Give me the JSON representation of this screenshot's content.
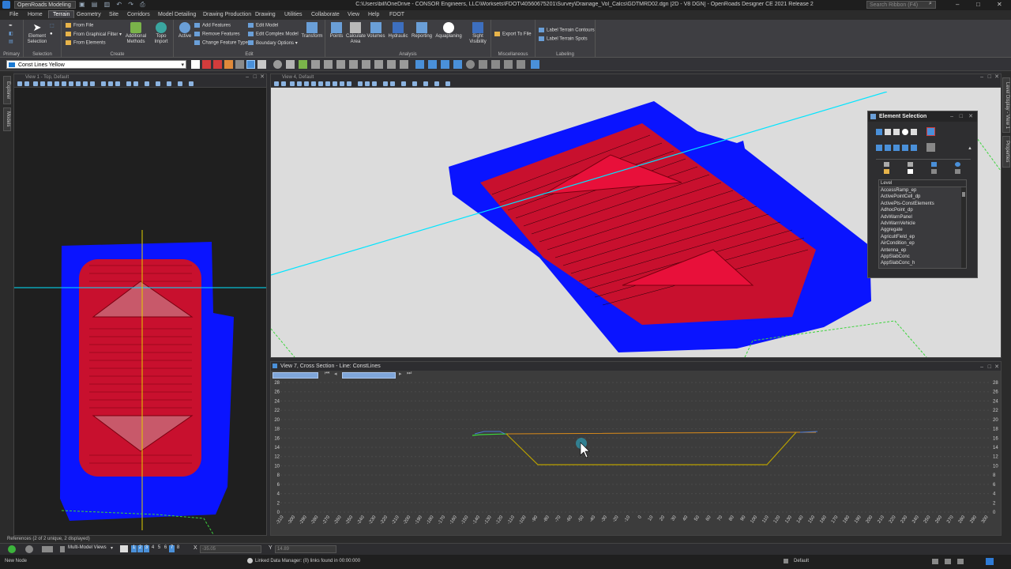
{
  "titlebar": {
    "workspace": "OpenRoads Modeling",
    "title": "C:\\Users\\bill\\OneDrive - CONSOR Engineers, LLC\\Worksets\\FDOT\\40560675201\\Survey\\Drainage_Vol_Calcs\\GDTMRD02.dgn [2D - V8 DGN] - OpenRoads Designer CE 2021 Release 2",
    "search_placeholder": "Search Ribbon (F4)"
  },
  "menu_tabs": [
    "File",
    "Home",
    "Terrain",
    "Geometry",
    "Site",
    "Corridors",
    "Model Detailing",
    "Drawing Production",
    "Drawing",
    "Utilities",
    "Collaborate",
    "View",
    "Help",
    "FDOT"
  ],
  "active_tab": "Terrain",
  "ribbon": {
    "groups": [
      {
        "label": "Primary"
      },
      {
        "label": "Selection"
      },
      {
        "label": "Create"
      },
      {
        "label": "Edit"
      },
      {
        "label": "Analysis"
      },
      {
        "label": "Miscellaneous"
      },
      {
        "label": "Labeling"
      }
    ],
    "element_selection": "Element Selection",
    "create_items": [
      "From File",
      "From Graphical Filter",
      "From Elements"
    ],
    "additional_methods": "Additional Methods",
    "topo_import": "Topo Import",
    "active": "Active",
    "edit_items": [
      "Add Features",
      "Remove Features",
      "Change Feature Type"
    ],
    "edit_items2": [
      "Edit Model",
      "Edit Complex Model",
      "Boundary Options"
    ],
    "transform": "Transform",
    "analysis_items": [
      "Points",
      "Calculate Area",
      "Volumes",
      "Hydraulic",
      "Reporting",
      "Aquaplaning",
      "Sight Visibility"
    ],
    "export_to_file": "Export To File",
    "labeling_items": [
      "Label Terrain Contours",
      "Label Terrain Spots"
    ]
  },
  "attributes": {
    "level": "Const Lines Yellow"
  },
  "views": {
    "view1_title": "View 1 - Top, Default",
    "view4_title": "View 4, Default",
    "view7_title": "View 7, Cross Section - Line: ConstLines"
  },
  "element_selection": {
    "title": "Element Selection",
    "list_header": "Level",
    "levels": [
      "AccessRamp_ep",
      "ActivePointCell_dp",
      "ActivePts-ConstElements",
      "AdhocPoint_dp",
      "AdvWarnPanel",
      "AdvWarnVehicle",
      "Aggregate",
      "AgricultField_ep",
      "AirCondition_ep",
      "Antenna_ep",
      "AppSlabConc",
      "AppSlabConc_h"
    ]
  },
  "cross_section": {
    "y_ticks": [
      "28",
      "26",
      "24",
      "22",
      "20",
      "18",
      "16",
      "14",
      "12",
      "10",
      "8",
      "6",
      "4",
      "2",
      "0"
    ],
    "x_ticks": [
      "-310",
      "-300",
      "-290",
      "-280",
      "-270",
      "-260",
      "-250",
      "-240",
      "-230",
      "-220",
      "-210",
      "-200",
      "-190",
      "-180",
      "-170",
      "-160",
      "-150",
      "-140",
      "-130",
      "-120",
      "-110",
      "-100",
      "-90",
      "-80",
      "-70",
      "-60",
      "-50",
      "-40",
      "-30",
      "-20",
      "-10",
      "0",
      "10",
      "20",
      "30",
      "40",
      "50",
      "60",
      "70",
      "80",
      "90",
      "100",
      "110",
      "120",
      "130",
      "140",
      "150",
      "160",
      "170",
      "180",
      "190",
      "200",
      "210",
      "220",
      "230",
      "240",
      "250",
      "260",
      "270",
      "280",
      "290",
      "300"
    ]
  },
  "status": {
    "references": "References (2 of 2 unique, 2 displayed)",
    "view_mode": "Multi-Model Views",
    "view_numbers": [
      "1",
      "2",
      "3",
      "4",
      "5",
      "6",
      "7",
      "8"
    ],
    "x_label": "X",
    "x_value": "-35.05",
    "y_label": "Y",
    "y_value": "14.89",
    "prompt": "New Node",
    "linked_data": "Linked Data Manager: (0) links found in 00:00:000",
    "model": "Default"
  },
  "colors": {
    "accent": "#4a90d9",
    "pond_outer": "#0a14ff",
    "pond_inner": "#c8102e",
    "section_line": "#00e5ff",
    "ribbon_bg": "#3e3e42"
  }
}
